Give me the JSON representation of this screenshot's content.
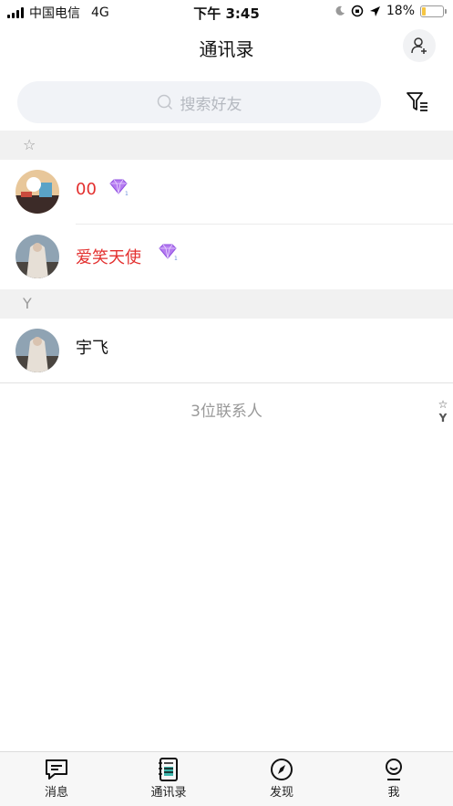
{
  "status_bar": {
    "carrier": "中国电信",
    "network": "4G",
    "time": "下午 3:45",
    "battery": "18%",
    "battery_level": 0.18
  },
  "header": {
    "title": "通讯录"
  },
  "search": {
    "placeholder": "搜索好友"
  },
  "sections": [
    {
      "key": "☆",
      "contacts": [
        {
          "name": "00",
          "vip": true
        },
        {
          "name": "爱笑天使",
          "vip": true
        }
      ]
    },
    {
      "key": "Y",
      "contacts": [
        {
          "name": "宇飞",
          "vip": false
        }
      ]
    }
  ],
  "footer": {
    "count_text": "3位联系人"
  },
  "index_bar": [
    "☆",
    "Y"
  ],
  "tabs": [
    {
      "label": "消息",
      "icon": "message-icon"
    },
    {
      "label": "通讯录",
      "icon": "contacts-icon",
      "active": true
    },
    {
      "label": "发现",
      "icon": "compass-icon"
    },
    {
      "label": "我",
      "icon": "profile-icon"
    }
  ],
  "colors": {
    "vip_name": "#e3302f",
    "accent": "#3fb8af",
    "section_bg": "#f1f1f1"
  }
}
